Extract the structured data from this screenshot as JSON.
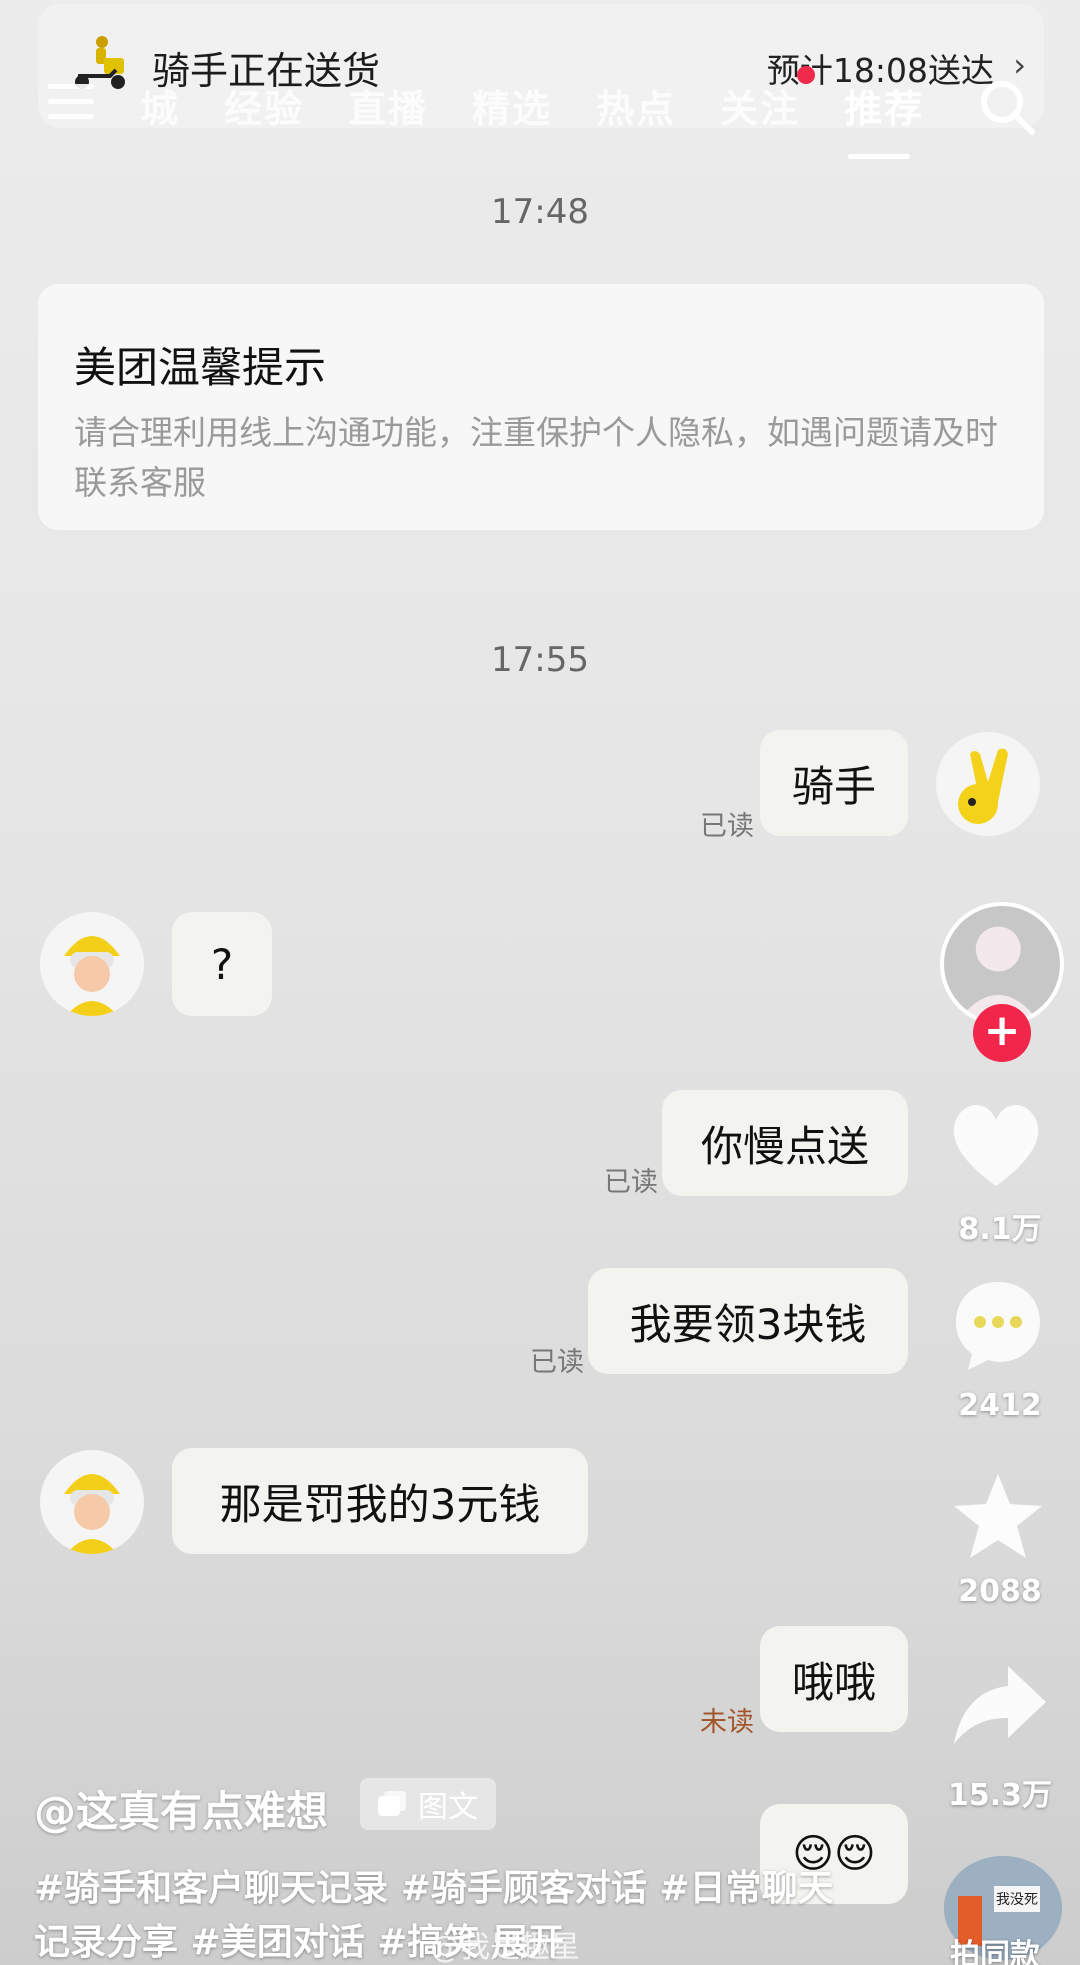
{
  "banner": {
    "title": "骑手正在送货",
    "eta": "预计18:08送达",
    "chevron": "›"
  },
  "nav": {
    "tabs": [
      "城",
      "经验",
      "直播",
      "精选",
      "热点",
      "关注",
      "推荐"
    ],
    "active_tab": "推荐"
  },
  "chat": {
    "time1": "17:48",
    "notice_title": "美团温馨提示",
    "notice_body": "请合理利用线上沟通功能，注重保护个人隐私，如遇问题请及时联系客服",
    "time2": "17:55",
    "messages": [
      {
        "side": "right",
        "text": "骑手",
        "status": "已读"
      },
      {
        "side": "left",
        "text": "?"
      },
      {
        "side": "right",
        "text": "你慢点送",
        "status": "已读"
      },
      {
        "side": "right",
        "text": "我要领3块钱",
        "status": "已读"
      },
      {
        "side": "left",
        "text": "那是罚我的3元钱"
      },
      {
        "side": "right",
        "text": "哦哦",
        "status": "未读"
      },
      {
        "side": "right",
        "text": "😌😌"
      }
    ]
  },
  "rail": {
    "likes": "8.1万",
    "comments": "2412",
    "favorites": "2088",
    "shares": "15.3万",
    "sound": "拍同款",
    "sound_thumb_text": "我没死"
  },
  "post": {
    "author": "@这真有点难想",
    "badge": "图文",
    "caption": "#骑手和客户聊天记录 #骑手顾客对话 #日常聊天记录分享 #美团对话 #搞笑",
    "expand": "展开",
    "watermark": "@我是趣星"
  },
  "colors": {
    "accent_red": "#f02a4a",
    "bubble": "#f3f3f0",
    "unread": "#a3562c"
  },
  "icons": [
    "courier-scooter-icon",
    "menu-icon",
    "search-icon",
    "plus-icon",
    "heart-icon",
    "comment-icon",
    "star-icon",
    "share-icon",
    "image-text-icon",
    "weibo-icon"
  ]
}
